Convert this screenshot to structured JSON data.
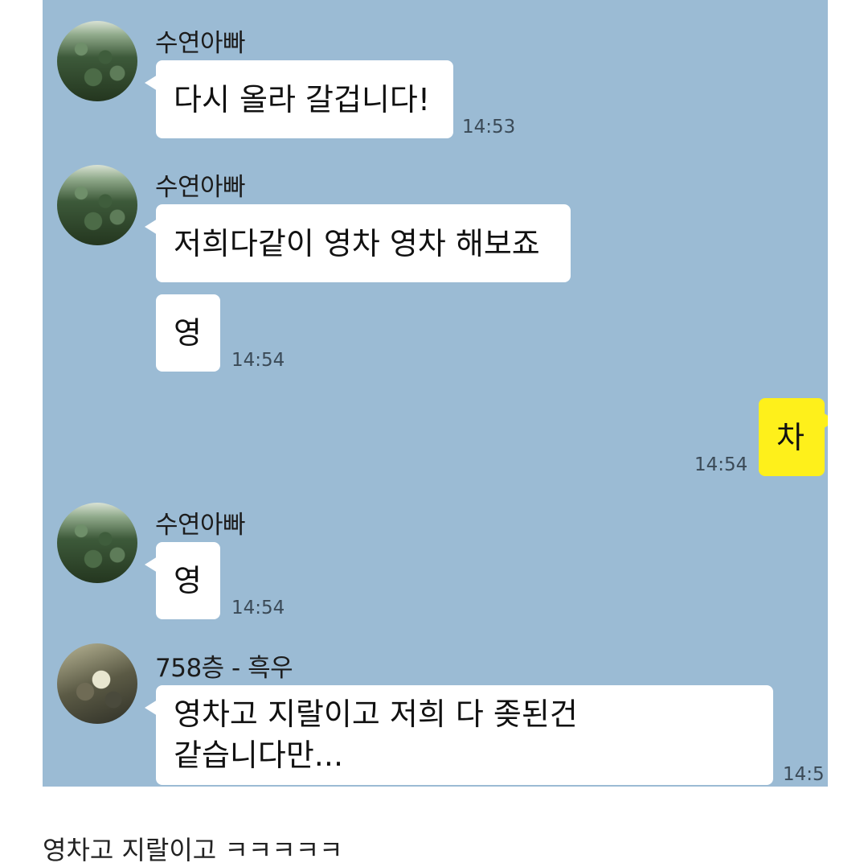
{
  "messages": [
    {
      "sender": "수연아빠",
      "text": "다시 올라 갈겁니다!",
      "time": "14:53"
    },
    {
      "sender": "수연아빠",
      "text": "저희다같이 영차 영차 해보죠"
    },
    {
      "text": "영",
      "time": "14:54"
    },
    {
      "text": "차",
      "time": "14:54",
      "mine": true
    },
    {
      "sender": "수연아빠",
      "text": "영",
      "time": "14:54"
    },
    {
      "sender": "758층 - 흑우",
      "line1": "영차고 지랄이고 저희 다 좆된건",
      "line2": "같습니다만...",
      "time": "14:5"
    }
  ],
  "caption": "영차고 지랄이고 ㅋㅋㅋㅋㅋ",
  "colors": {
    "chat_background": "#9bbbd4",
    "other_bubble": "#ffffff",
    "my_bubble": "#fef01b"
  },
  "icons": {
    "avatar_1": "forest-avatar",
    "avatar_2": "room-avatar"
  }
}
